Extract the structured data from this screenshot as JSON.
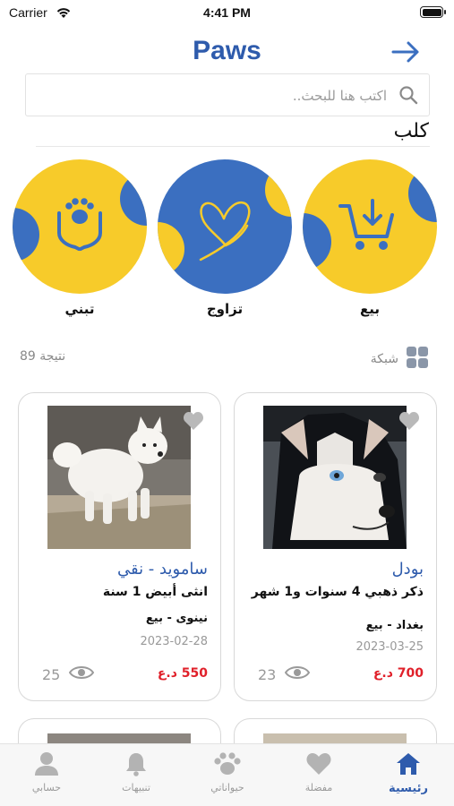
{
  "status_bar": {
    "carrier": "Carrier",
    "time": "4:41 PM"
  },
  "header": {
    "title": "Paws"
  },
  "search": {
    "placeholder": "اكتب هنا للبحث.."
  },
  "category": {
    "label": "كلب"
  },
  "actions": [
    {
      "label": "بيع",
      "icon": "cart-download-icon"
    },
    {
      "label": "تزاوج",
      "icon": "heart-icon"
    },
    {
      "label": "تبني",
      "icon": "hands-paw-icon"
    }
  ],
  "results": {
    "count": "89 نتيجة",
    "view_label": "شبكة"
  },
  "listings": [
    {
      "breed": "بودل",
      "description": "ذكر ذهبي 4 سنوات و1 شهر",
      "location": "بغداد - بيع",
      "date": "2023-03-25",
      "price": "700 د.ع",
      "views": "23"
    },
    {
      "breed": "ساموید - نقي",
      "description": "انثى أبيض 1 سنة",
      "location": "نينوى - بيع",
      "date": "2023-02-28",
      "price": "550 د.ع",
      "views": "25"
    }
  ],
  "tabs": [
    {
      "label": "رئيسية",
      "active": true
    },
    {
      "label": "مفضلة",
      "active": false
    },
    {
      "label": "حيواناتي",
      "active": false
    },
    {
      "label": "تنبيهات",
      "active": false
    },
    {
      "label": "حسابي",
      "active": false
    }
  ],
  "colors": {
    "brand_blue": "#3b6fc0",
    "brand_yellow": "#f7cb2a",
    "price_red": "#e0202a"
  }
}
